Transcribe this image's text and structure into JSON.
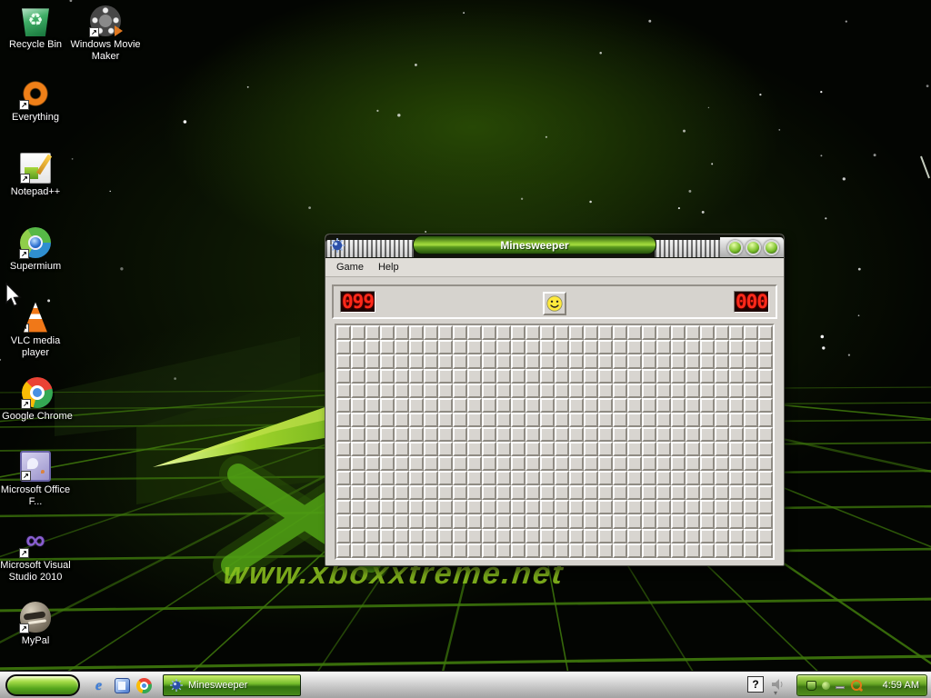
{
  "desktop": {
    "wallpaper_text": "www.xboxxtreme.net",
    "icons": [
      {
        "label": "Recycle Bin",
        "icon": "recycle-bin-icon",
        "shortcut": false
      },
      {
        "label": "Windows Movie Maker",
        "icon": "movie-maker-icon",
        "shortcut": true
      },
      {
        "label": "Everything",
        "icon": "everything-icon",
        "shortcut": true
      },
      {
        "label": "Notepad++",
        "icon": "notepad-plus-plus-icon",
        "shortcut": true
      },
      {
        "label": "Supermium",
        "icon": "supermium-icon",
        "shortcut": true
      },
      {
        "label": "VLC media player",
        "icon": "vlc-icon",
        "shortcut": true
      },
      {
        "label": "Google Chrome",
        "icon": "chrome-icon",
        "shortcut": true
      },
      {
        "label": "Microsoft Office F...",
        "icon": "office-icon",
        "shortcut": true
      },
      {
        "label": "Microsoft Visual Studio 2010",
        "icon": "visual-studio-icon",
        "shortcut": true
      },
      {
        "label": "MyPal",
        "icon": "mypal-icon",
        "shortcut": true
      }
    ]
  },
  "minesweeper": {
    "title": "Minesweeper",
    "menu": [
      {
        "label": "Game"
      },
      {
        "label": "Help"
      }
    ],
    "mine_counter": "099",
    "timer": "000",
    "smiley": "happy",
    "grid": {
      "rows": 16,
      "cols": 30
    }
  },
  "taskbar": {
    "task_buttons": [
      {
        "label": "Minesweeper"
      }
    ],
    "help_glyph": "?",
    "clock": "4:59 AM"
  },
  "colors": {
    "accent_green": "#8dc63f",
    "wallpaper_line_green": "#3f7a0c",
    "led_red": "#ff2a1a",
    "title_text": "#ffffff"
  }
}
